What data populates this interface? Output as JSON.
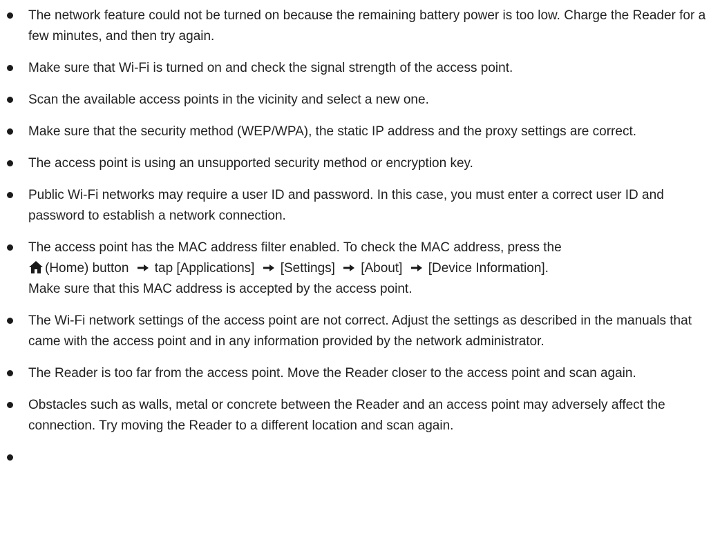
{
  "items": [
    {
      "text": "The network feature could not be turned on because the remaining battery power is too low. Charge the Reader for a few minutes, and then try again."
    },
    {
      "text": "Make sure that Wi-Fi is turned on and check the signal strength of the access point."
    },
    {
      "text": "Scan the available access points in the vicinity and select a new one."
    },
    {
      "text": "Make sure that the security method (WEP/WPA), the static IP address and the proxy settings are correct."
    },
    {
      "text": "The access point is using an unsupported security method or encryption key."
    },
    {
      "text": "Public Wi-Fi networks may require a user ID and password. In this case, you must enter a correct user ID and password to establish a network connection."
    },
    {
      "intro": "The access point has the MAC address filter enabled. To check the MAC address, press the",
      "home_label": "(Home) button",
      "step_1": "tap [Applications]",
      "step_2": "[Settings]",
      "step_3": "[About]",
      "step_4": "[Device Information].",
      "outro": "Make sure that this MAC address is accepted by the access point.",
      "icons": [
        "home-icon",
        "arrow-right-icon"
      ]
    },
    {
      "text": "The Wi-Fi network settings of the access point are not correct. Adjust the settings as described in the manuals that came with the access point and in any information provided by the network administrator."
    },
    {
      "text": "The Reader is too far from the access point. Move the Reader closer to the access point and scan again."
    },
    {
      "text": "Obstacles such as walls, metal or concrete between the Reader and an access point may adversely affect the connection. Try moving the Reader to a different location and scan again."
    },
    {
      "text": ""
    }
  ],
  "colors": {
    "text": "#222222",
    "bullet": "#1a1a1a"
  }
}
